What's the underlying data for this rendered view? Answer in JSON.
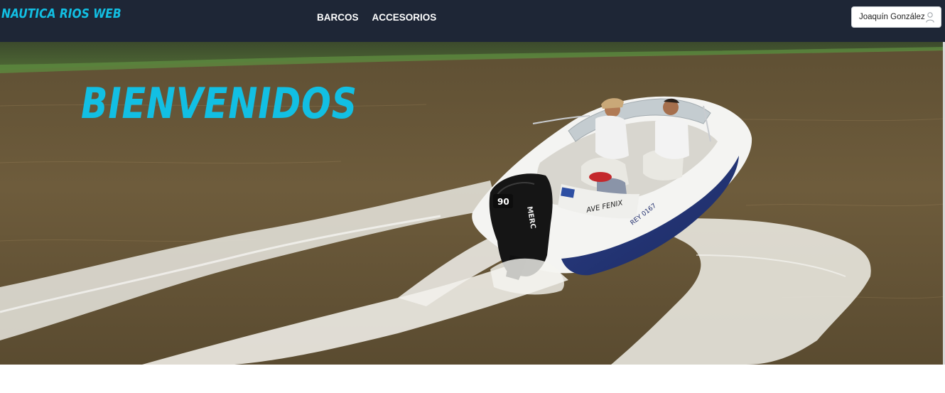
{
  "navbar": {
    "brand": "NAUTICA RIOS WEB",
    "links": [
      {
        "label": "BARCOS"
      },
      {
        "label": "ACCESORIOS"
      }
    ],
    "user": {
      "name": "Joaquín González",
      "icon": "user-icon"
    }
  },
  "hero": {
    "title": "BIENVENIDOS",
    "image": {
      "description_icon": "motorboat-photo",
      "boat_labels": {
        "engine_power": "90",
        "engine_brand": "MERC",
        "boat_name": "AVE FENIX",
        "registration": "REY 0167"
      }
    }
  },
  "colors": {
    "navbar_bg": "#1e2636",
    "accent": "#12bfe3",
    "water": "#6b5a3a"
  }
}
